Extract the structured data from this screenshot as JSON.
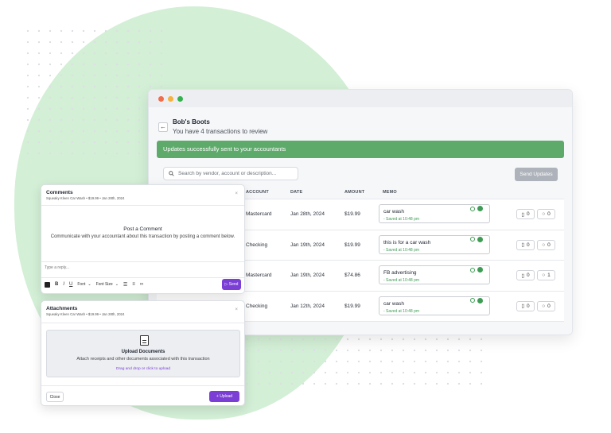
{
  "company": {
    "name": "Bob's Boots",
    "subtitle": "You have 4 transactions to review"
  },
  "banner": {
    "text": "Updates successfully sent to your accountants",
    "color": "#5eaa6b"
  },
  "search": {
    "placeholder": "Search by vendor, account or description..."
  },
  "send_updates_label": "Send Updates",
  "table": {
    "headers": {
      "account": "ACCOUNT",
      "date": "DATE",
      "amount": "AMOUNT",
      "memo": "MEMO"
    },
    "rows": [
      {
        "account": "Mastercard",
        "date": "Jan 28th, 2024",
        "amount": "$19.99",
        "memo": "car wash",
        "saved": "- Saved at 10:48 pm",
        "attachments": "0",
        "comments": "0"
      },
      {
        "account": "Checking",
        "date": "Jan 19th, 2024",
        "amount": "$19.99",
        "memo": "this is for a car wash",
        "saved": "- Saved at 10:48 pm",
        "attachments": "0",
        "comments": "0"
      },
      {
        "account": "Mastercard",
        "date": "Jan 19th, 2024",
        "amount": "$74.86",
        "memo": "FB advertising",
        "saved": "- Saved at 10:48 pm",
        "attachments": "0",
        "comments": "1"
      },
      {
        "account": "Checking",
        "date": "Jan 12th, 2024",
        "amount": "$19.99",
        "memo": "car wash",
        "saved": "- Saved at 10:48 pm",
        "attachments": "0",
        "comments": "0"
      }
    ]
  },
  "comments_panel": {
    "title": "Comments",
    "subtitle": "Squeaky Kleen Car Wash • $19.99 • Jan 28th, 2024",
    "empty_title": "Post a Comment",
    "empty_desc": "Communicate with your accountant about this transaction by posting a comment below.",
    "reply_placeholder": "Type a reply...",
    "toolbar": {
      "bold": "B",
      "italic": "I",
      "underline": "U",
      "font": "Font",
      "font_size": "Font Size"
    },
    "send_label": "Send"
  },
  "attachments_panel": {
    "title": "Attachments",
    "subtitle": "Squeaky Kleen Car Wash • $19.99 • Jan 28th, 2024",
    "upload_title": "Upload Documents",
    "upload_desc": "Attach receipts and other documents associated with this transaction",
    "upload_link": "Drag and drop or click to upload",
    "close_label": "Close",
    "upload_label": "+ Upload"
  },
  "colors": {
    "accent_purple": "#7b3fd6",
    "success_green": "#3f9c55",
    "blob_green": "#d3efd6"
  }
}
